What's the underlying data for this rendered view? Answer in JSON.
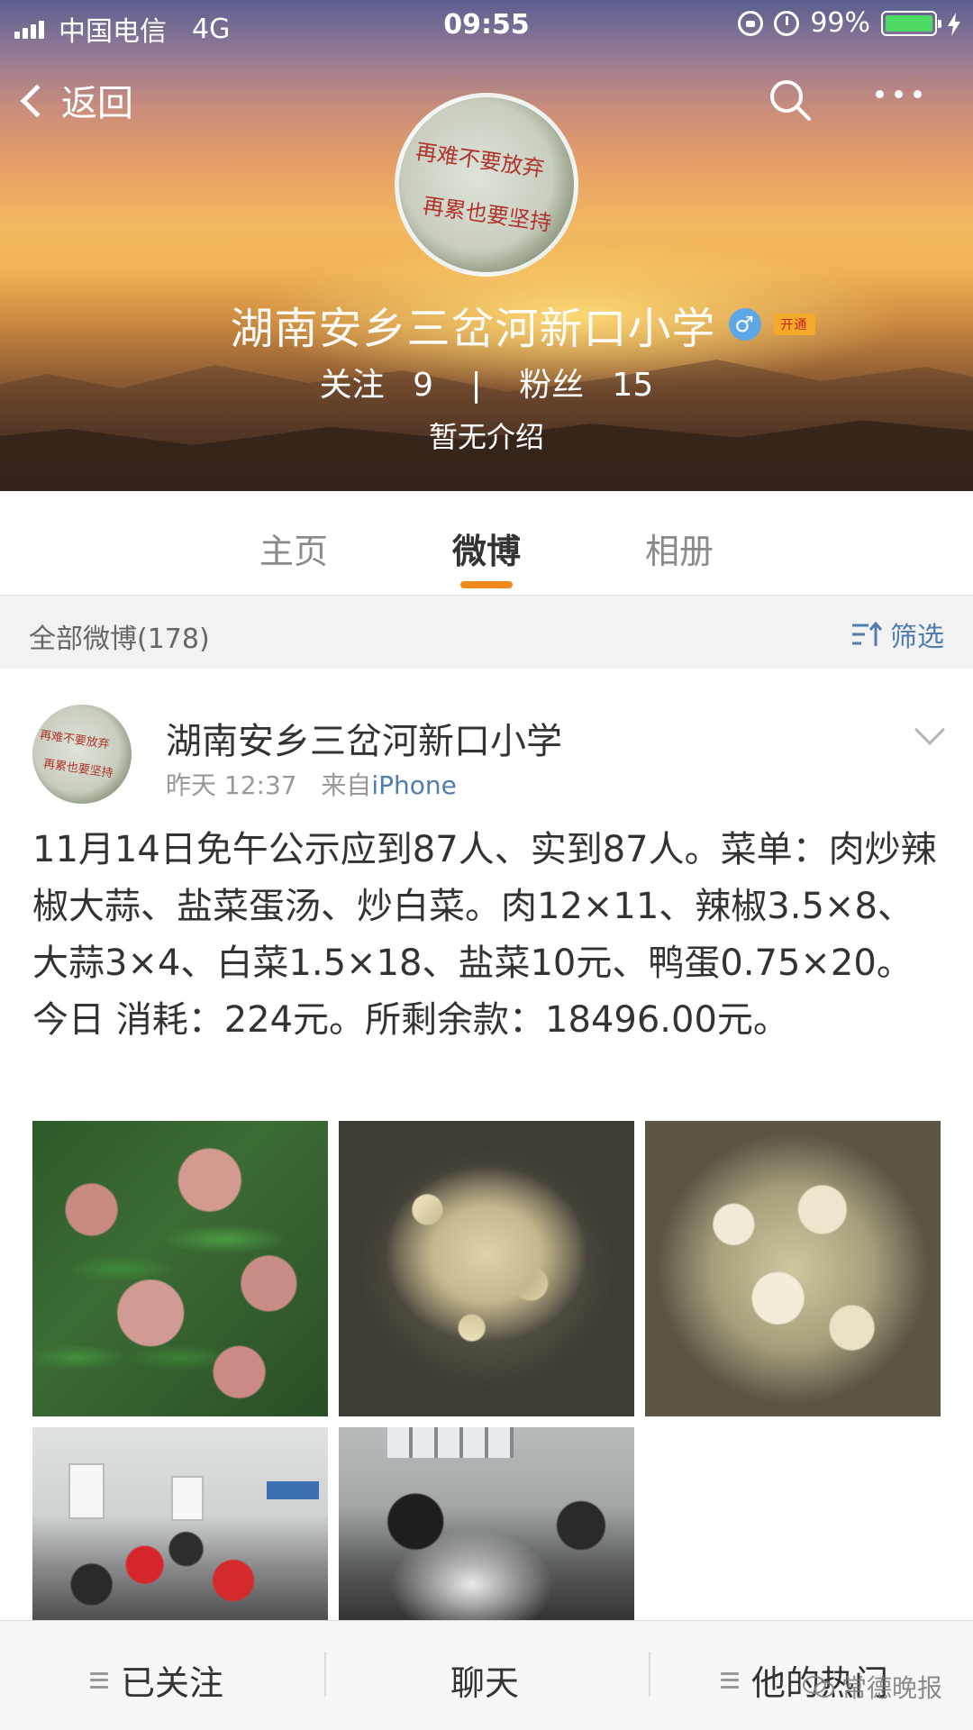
{
  "status_bar": {
    "carrier": "中国电信",
    "network": "4G",
    "time": "09:55",
    "battery": "99%"
  },
  "nav": {
    "back_label": "返回"
  },
  "profile": {
    "avatar_text_line1": "再难不要放弃",
    "avatar_text_line2": "再累也要坚持",
    "name": "湖南安乡三岔河新口小学",
    "gender": "♂",
    "badge": "开通",
    "following_label": "关注",
    "following_count": "9",
    "separator": "|",
    "followers_label": "粉丝",
    "followers_count": "15",
    "bio": "暂无介绍"
  },
  "tabs": [
    {
      "label": "主页",
      "active": false
    },
    {
      "label": "微博",
      "active": true
    },
    {
      "label": "相册",
      "active": false
    }
  ],
  "filter": {
    "count_label": "全部微博(178)",
    "filter_label": "筛选"
  },
  "post": {
    "author": "湖南安乡三岔河新口小学",
    "time": "昨天 12:37",
    "source_prefix": "来自",
    "source": "iPhone",
    "text": "11月14日免午公示应到87人、实到87人。菜单：肉炒辣椒大蒜、盐菜蛋汤、炒白菜。肉12×11、辣椒3.5×8、大蒜3×4、白菜1.5×18、盐菜10元、鸭蛋0.75×20。今日 消耗：224元。所剩余款：18496.00元。",
    "photo_count": 5
  },
  "bottom_bar": {
    "followed_label": "已关注",
    "chat_label": "聊天",
    "hot_label": "他的热门"
  },
  "watermark": "常德晚报",
  "colors": {
    "accent_orange": "#f08a1c",
    "link_blue": "#507daf",
    "battery_green": "#4cd964"
  }
}
